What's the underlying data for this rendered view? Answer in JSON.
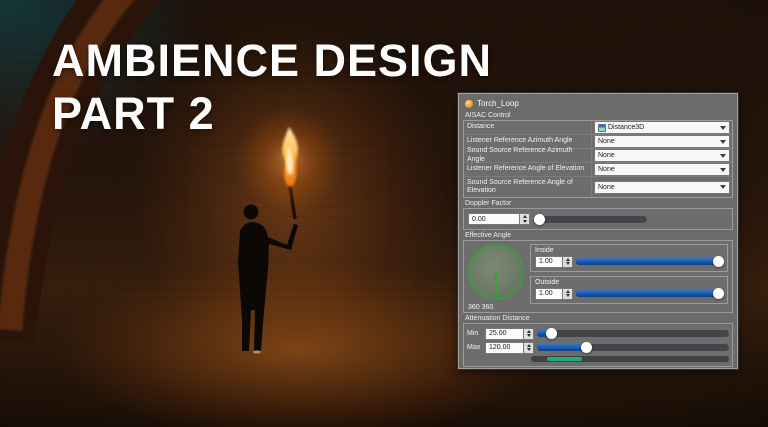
{
  "title": {
    "line1": "AMBIENCE DESIGN",
    "line2": "PART 2"
  },
  "panel": {
    "header": {
      "title": "Torch_Loop",
      "icon": "orange-cue-sphere"
    },
    "aisac": {
      "group_label": "AISAC Control",
      "rows": [
        {
          "label": "Distance",
          "value": "Distance3D",
          "value_icon": "aisac-curve-icon"
        },
        {
          "label": "Listener Reference Azimuth Angle",
          "value": "None"
        },
        {
          "label": "Sound Source Reference Azimuth Angle",
          "value": "None"
        },
        {
          "label": "Listener Reference Angle of Elevation",
          "value": "None"
        },
        {
          "label": "Sound Source Reference Angle of Elevation",
          "value": "None"
        }
      ]
    },
    "doppler": {
      "group_label": "Doppler Factor",
      "value": "0.00",
      "slider_pos_pct": 0
    },
    "effective_angle": {
      "group_label": "Effective Angle",
      "angle_readout": "360 360",
      "inside": {
        "label": "Inside",
        "value": "1.00",
        "slider_pos_pct": 100
      },
      "outside": {
        "label": "Outside",
        "value": "1.00",
        "slider_pos_pct": 100
      }
    },
    "attenuation": {
      "group_label": "Attenuation Distance",
      "min": {
        "label": "Min",
        "value": "25.00",
        "slider_pos_pct": 8
      },
      "max": {
        "label": "Max",
        "value": "120.00",
        "slider_pos_pct": 26
      },
      "range_bar": {
        "start_pct": 8,
        "end_pct": 26
      }
    },
    "colors": {
      "panel_gray": "#6b6b6b",
      "slider_blue": "#1d5fae",
      "range_green": "#1fae72",
      "angle_green": "#3c9c3c",
      "cue_orange": "#f0a131"
    }
  }
}
